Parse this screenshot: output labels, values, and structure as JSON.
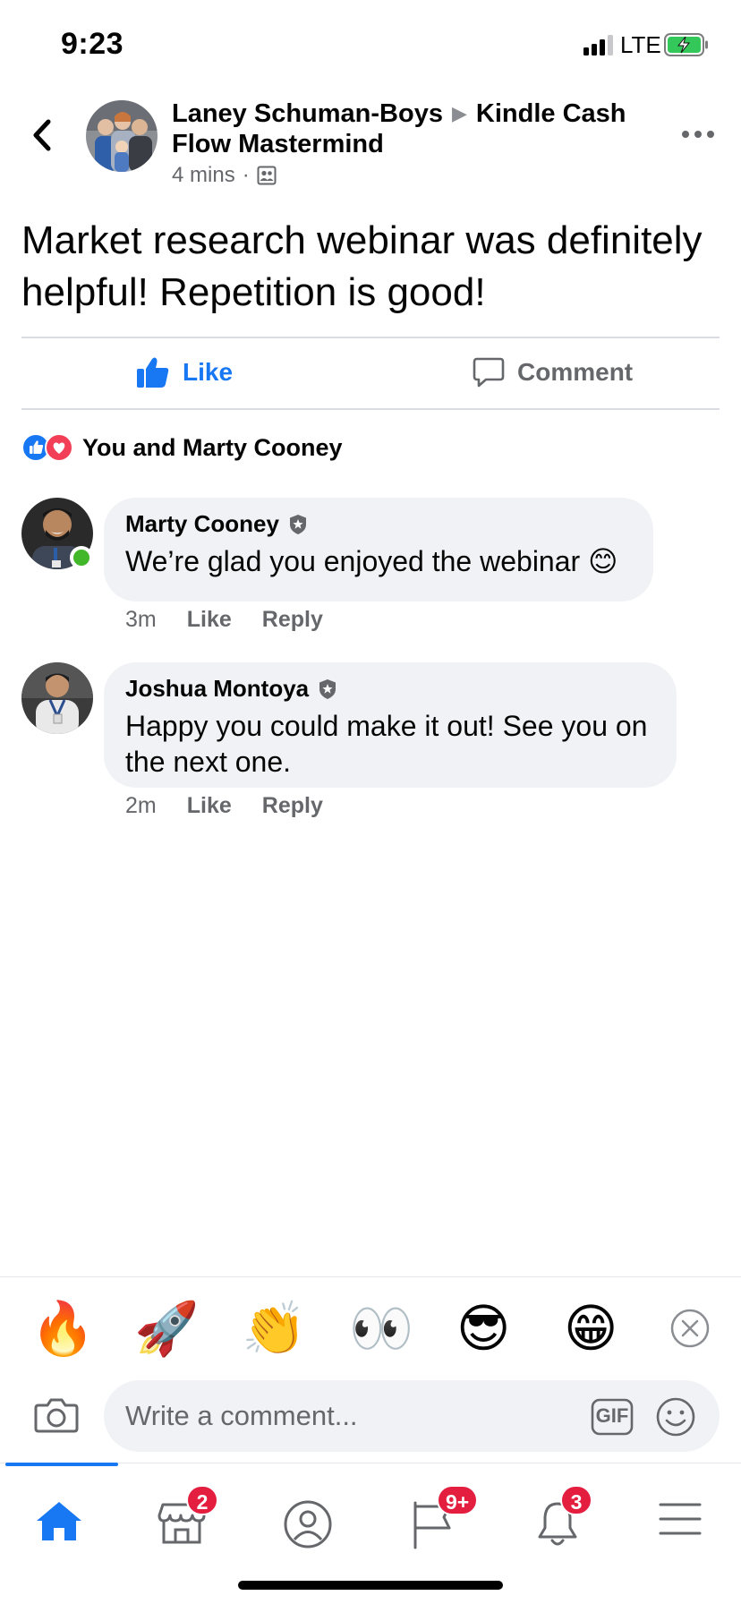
{
  "status_bar": {
    "time": "9:23",
    "network": "LTE"
  },
  "header": {
    "author": "Laney Schuman-Boys",
    "group": "Kindle Cash Flow Mastermind",
    "time": "4 mins",
    "privacy_icon": "group-members-icon"
  },
  "post": {
    "text": "Market research webinar was definitely helpful!  Repetition is good!"
  },
  "actions": {
    "like_label": "Like",
    "comment_label": "Comment"
  },
  "reactions": {
    "icons": [
      "like-reaction-icon",
      "love-reaction-icon"
    ],
    "text": "You and Marty Cooney"
  },
  "comments": [
    {
      "name": "Marty Cooney",
      "text": "We’re glad you enjoyed the webinar 😊",
      "time": "3m",
      "like": "Like",
      "reply": "Reply",
      "online": true
    },
    {
      "name": "Joshua Montoya",
      "text": "Happy you could make it out! See you on the next one.",
      "time": "2m",
      "like": "Like",
      "reply": "Reply",
      "online": false
    }
  ],
  "emoji_bar": {
    "emojis": [
      "🔥",
      "🚀",
      "👏",
      "👀",
      "😎",
      "😁"
    ]
  },
  "comment_input": {
    "placeholder": "Write a comment...",
    "gif_label": "GIF"
  },
  "tabbar": {
    "tabs": [
      {
        "name": "home",
        "badge": ""
      },
      {
        "name": "marketplace",
        "badge": "2"
      },
      {
        "name": "profile",
        "badge": ""
      },
      {
        "name": "pages",
        "badge": "9+"
      },
      {
        "name": "notifications",
        "badge": "3"
      },
      {
        "name": "menu",
        "badge": ""
      }
    ]
  },
  "colors": {
    "accent": "#1877f2",
    "text_secondary": "#65676b",
    "bubble": "#f0f2f5",
    "badge": "#e41e3f",
    "online": "#42b72a"
  }
}
